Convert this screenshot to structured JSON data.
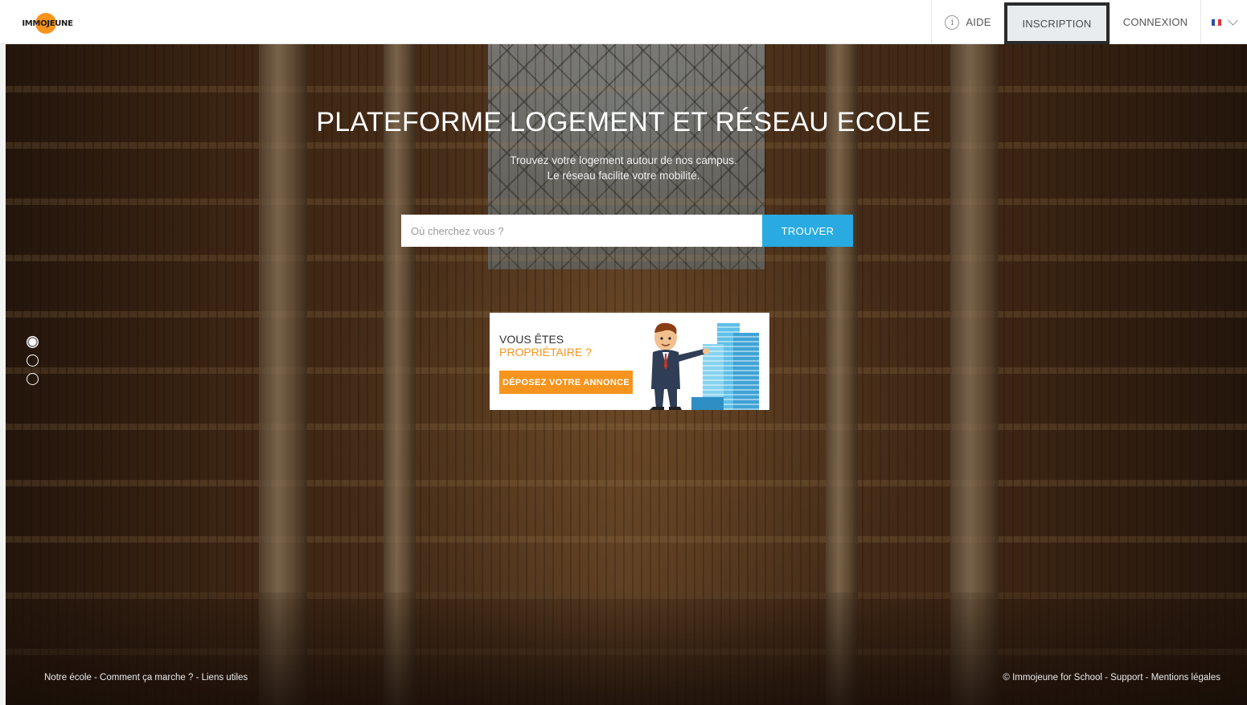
{
  "header": {
    "logo_text": "IMMOJEUNE",
    "nav": {
      "aide_label": "AIDE",
      "inscription_label": "INSCRIPTION",
      "connexion_label": "CONNEXION",
      "language_flag": "flag-fr-icon"
    }
  },
  "hero": {
    "title": "PLATEFORME LOGEMENT ET RÉSEAU ECOLE",
    "subtitle_line1": "Trouvez votre logement autour de nos campus.",
    "subtitle_line2": "Le réseau facilite votre mobilité.",
    "search": {
      "placeholder": "Où cherchez vous ?",
      "button_label": "TROUVER"
    },
    "owner_card": {
      "line1": "VOUS ÊTES",
      "line2": "PROPRIÉTAIRE ?",
      "button_label": "DÉPOSEZ VOTRE ANNONCE"
    },
    "slider": {
      "count": 3,
      "active": 0
    }
  },
  "footer": {
    "left": {
      "notre_ecole": "Notre école",
      "sep1": " - ",
      "comment": "Comment ça marche ?",
      "sep2": " - ",
      "liens": "Liens utiles"
    },
    "right": {
      "copyright": "© Immojeune for School",
      "sep1": " - ",
      "support": "Support",
      "sep2": " - ",
      "mentions": "Mentions légales"
    }
  },
  "colors": {
    "accent_orange": "#f7941d",
    "accent_blue": "#29abe2",
    "inscription_border": "#2b2b2b"
  }
}
